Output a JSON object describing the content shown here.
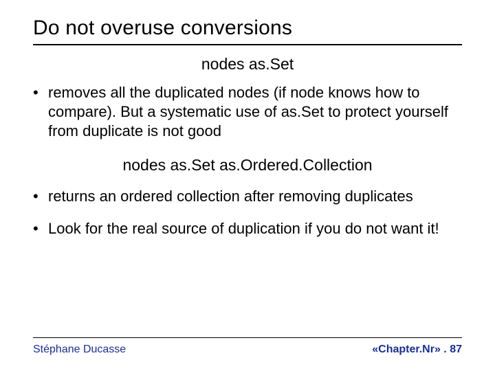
{
  "title": "Do not overuse conversions",
  "code1": "nodes as.Set",
  "bullets1": [
    "removes all the duplicated nodes (if node knows how to compare). But a systematic use of as.Set to protect yourself from duplicate is not good"
  ],
  "code2": "nodes as.Set as.Ordered.Collection",
  "bullets2": [
    "returns an ordered collection after removing duplicates",
    "Look for the real source of duplication if you do not want it!"
  ],
  "footer": {
    "author": "Stéphane Ducasse",
    "page": "«Chapter.Nr» . 87"
  },
  "colors": {
    "accent": "#1a2f8a"
  }
}
